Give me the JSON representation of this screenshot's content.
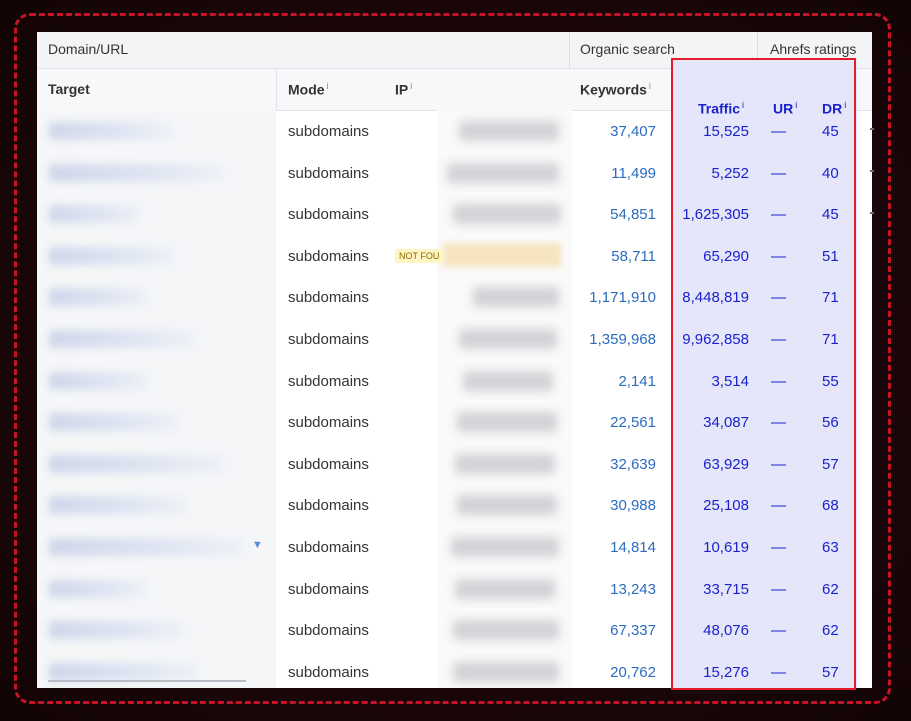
{
  "header": {
    "group_domain": "Domain/URL",
    "group_organic": "Organic search",
    "group_ahrefs": "Ahrefs ratings",
    "col_target": "Target",
    "col_mode": "Mode",
    "col_ip": "IP",
    "col_keywords": "Keywords",
    "col_traffic": "Traffic",
    "col_ur": "UR",
    "col_dr": "DR",
    "info_mark": "i"
  },
  "badge_not_found": "NOT FOU",
  "rows": [
    {
      "mode": "subdomains",
      "keywords": "37,407",
      "traffic": "15,525",
      "ur": "—",
      "dr": "45"
    },
    {
      "mode": "subdomains",
      "keywords": "11,499",
      "traffic": "5,252",
      "ur": "—",
      "dr": "40"
    },
    {
      "mode": "subdomains",
      "keywords": "54,851",
      "traffic": "1,625,305",
      "ur": "—",
      "dr": "45"
    },
    {
      "mode": "subdomains",
      "keywords": "58,711",
      "traffic": "65,290",
      "ur": "—",
      "dr": "51"
    },
    {
      "mode": "subdomains",
      "keywords": "1,171,910",
      "traffic": "8,448,819",
      "ur": "—",
      "dr": "71"
    },
    {
      "mode": "subdomains",
      "keywords": "1,359,968",
      "traffic": "9,962,858",
      "ur": "—",
      "dr": "71"
    },
    {
      "mode": "subdomains",
      "keywords": "2,141",
      "traffic": "3,514",
      "ur": "—",
      "dr": "55"
    },
    {
      "mode": "subdomains",
      "keywords": "22,561",
      "traffic": "34,087",
      "ur": "—",
      "dr": "56"
    },
    {
      "mode": "subdomains",
      "keywords": "32,639",
      "traffic": "63,929",
      "ur": "—",
      "dr": "57"
    },
    {
      "mode": "subdomains",
      "keywords": "30,988",
      "traffic": "25,108",
      "ur": "—",
      "dr": "68"
    },
    {
      "mode": "subdomains",
      "keywords": "14,814",
      "traffic": "10,619",
      "ur": "—",
      "dr": "63"
    },
    {
      "mode": "subdomains",
      "keywords": "13,243",
      "traffic": "33,715",
      "ur": "—",
      "dr": "62"
    },
    {
      "mode": "subdomains",
      "keywords": "67,337",
      "traffic": "48,076",
      "ur": "—",
      "dr": "62"
    },
    {
      "mode": "subdomains",
      "keywords": "20,762",
      "traffic": "15,276",
      "ur": "—",
      "dr": "57"
    }
  ],
  "colors": {
    "frame_dashed": "#c41426",
    "highlight_border": "#e41c29",
    "highlight_fill": "#e6e6fb",
    "highlight_text": "#1a22cc",
    "keyword_link": "#2b6cbf"
  }
}
